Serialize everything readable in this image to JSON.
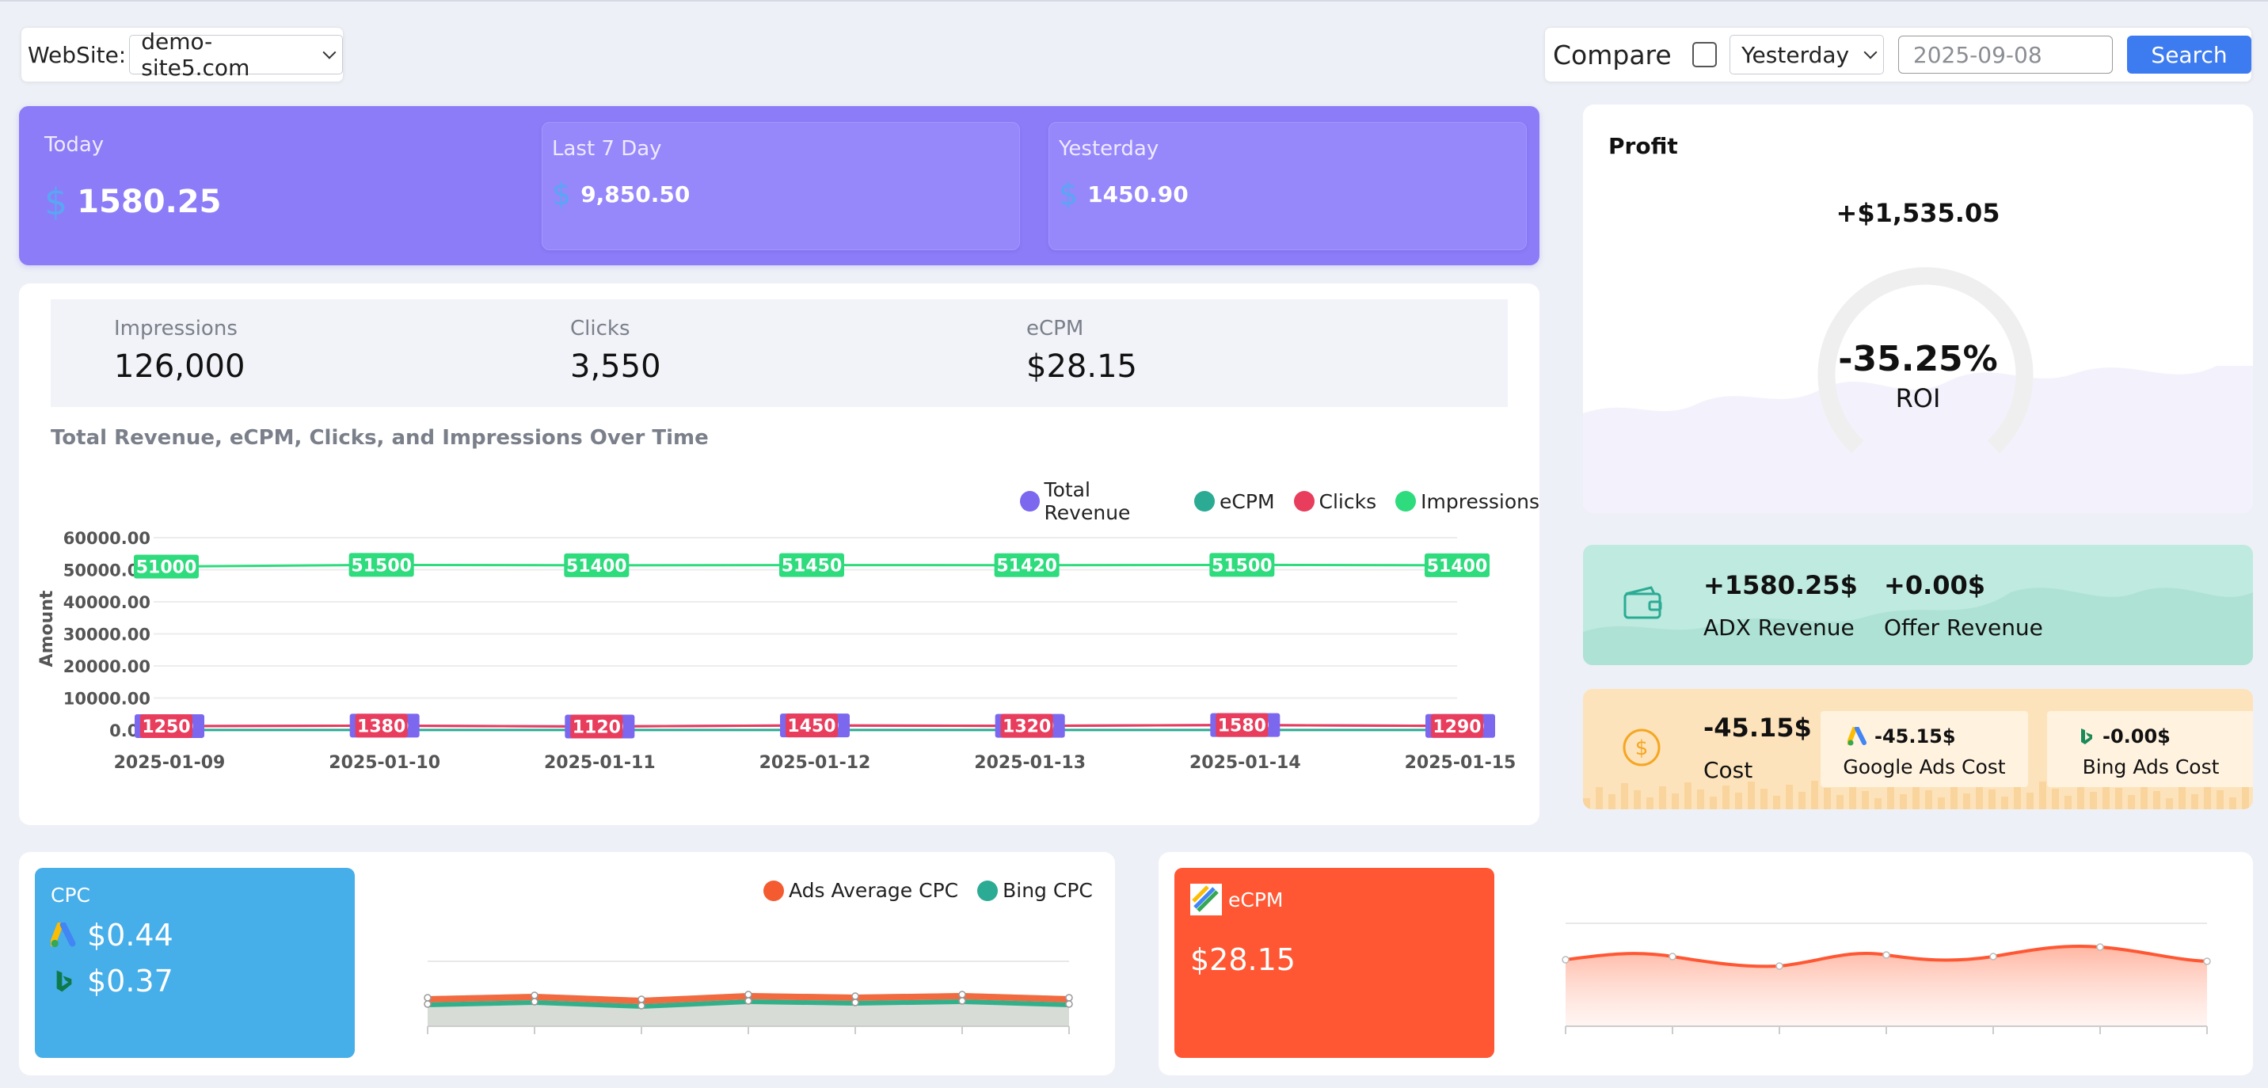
{
  "toolbar": {
    "website_label": "WebSite:",
    "website_value": "demo-site5.com",
    "compare_label": "Compare",
    "period_value": "Yesterday",
    "date_value": "2025-09-08",
    "search_label": "Search"
  },
  "revenue": {
    "today": {
      "title": "Today",
      "value": "1580.25",
      "currency": "$"
    },
    "last7": {
      "title": "Last 7 Day",
      "value": "9,850.50",
      "currency": "$"
    },
    "yesterday": {
      "title": "Yesterday",
      "value": "1450.90",
      "currency": "$"
    }
  },
  "kpis": [
    {
      "label": "Impressions",
      "value": "126,000"
    },
    {
      "label": "Clicks",
      "value": "3,550"
    },
    {
      "label": "eCPM",
      "value": "$28.15"
    }
  ],
  "chart_title": "Total Revenue, eCPM, Clicks, and Impressions Over Time",
  "chart_legend": [
    {
      "name": "Total Revenue",
      "color": "#7b68ee"
    },
    {
      "name": "eCPM",
      "color": "#2bab94"
    },
    {
      "name": "Clicks",
      "color": "#e83d5c"
    },
    {
      "name": "Impressions",
      "color": "#2edb7d"
    }
  ],
  "chart_data": {
    "type": "line",
    "ylabel": "Amount",
    "ylim": [
      0,
      60000
    ],
    "yticks": [
      "60000.00",
      "50000.00",
      "40000.00",
      "30000.00",
      "20000.00",
      "10000.00",
      "0.00"
    ],
    "x": [
      "2025-01-09",
      "2025-01-10",
      "2025-01-11",
      "2025-01-12",
      "2025-01-13",
      "2025-01-14",
      "2025-01-15"
    ],
    "series": [
      {
        "name": "Impressions",
        "values": [
          51000,
          51500,
          51400,
          51450,
          51420,
          51500,
          51400
        ]
      },
      {
        "name": "Clicks",
        "values": [
          1250,
          1380,
          1120,
          1450,
          1320,
          1580,
          1290
        ]
      },
      {
        "name": "Total Revenue",
        "values": [
          1250,
          1380,
          1120,
          1450,
          1320,
          1580,
          1290
        ]
      },
      {
        "name": "eCPM",
        "values": [
          28,
          28,
          28,
          28,
          28,
          28,
          28
        ]
      }
    ]
  },
  "profit": {
    "title": "Profit",
    "value": "+$1,535.05",
    "roi_value": "-35.25%",
    "roi_label": "ROI"
  },
  "adx": {
    "adx_value": "+1580.25$",
    "adx_label": "ADX Revenue",
    "offer_value": "+0.00$",
    "offer_label": "Offer Revenue"
  },
  "cost": {
    "value": "-45.15$",
    "label": "Cost",
    "google_value": "-45.15$",
    "google_label": "Google Ads Cost",
    "bing_value": "-0.00$",
    "bing_label": "Bing Ads Cost"
  },
  "cpc": {
    "title": "CPC",
    "google_value": "$0.44",
    "bing_value": "$0.37",
    "legend": [
      {
        "name": "Ads Average CPC",
        "color": "#f45b30"
      },
      {
        "name": "Bing CPC",
        "color": "#2bab94"
      }
    ]
  },
  "ecpm_card": {
    "title": "eCPM",
    "value": "$28.15"
  }
}
